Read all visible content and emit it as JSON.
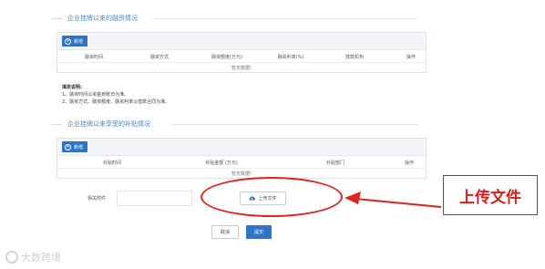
{
  "section1": {
    "title": "企业挂牌以来的融资情况",
    "add_label": "新增",
    "columns": [
      "融资时间",
      "融资方式",
      "融资额度(万元)",
      "融资利率(%)",
      "放款机构",
      "操作"
    ],
    "empty_text": "暂无数据!"
  },
  "notes": {
    "heading": "填表说明:",
    "line1": "1、融资时间以资金到账日为准。",
    "line2": "2、融资方式、融资额度、融资利率以借款合同为准。"
  },
  "section2": {
    "title": "企业挂牌以来享受的补贴情况",
    "add_label": "新增",
    "columns": [
      "补贴时间",
      "补贴金额 (万元)",
      "补贴部门",
      "操作"
    ],
    "empty_text": "暂无数据!"
  },
  "attachment": {
    "label": "相关附件",
    "upload_label": "上传文件"
  },
  "actions": {
    "cancel_label": "取消",
    "submit_label": "提交"
  },
  "annotation": {
    "callout_text": "上传文件",
    "color": "#e0241f"
  },
  "watermark": {
    "text": "大数跨境"
  },
  "colors": {
    "primary": "#2e74c7",
    "section_title": "#4a86c8"
  }
}
